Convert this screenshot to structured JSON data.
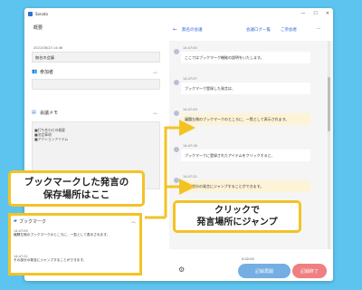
{
  "app": {
    "title": "Sonato"
  },
  "left": {
    "header": "概要",
    "date": "2021/08/23 14:46",
    "meeting_name": "無名の会議",
    "participants_label": "参加者",
    "memo_label": "会議メモ",
    "memo_lines": [
      "■打ち合わせの概要",
      "■決定事項",
      "■アクションアイテム"
    ],
    "bookmark_label": "ブックマーク",
    "bookmarks": [
      {
        "time": "14:47:09",
        "text": "議題左側のブックマークのところに、一覧として表示されます。"
      },
      {
        "time": "14:47:22",
        "text": "その部分の発言にジャンプすることができます。"
      }
    ]
  },
  "right": {
    "meeting_link": "無名の会議",
    "log_link": "会議ログ一覧",
    "users_link": "ご参加者",
    "messages": [
      {
        "time": "14:47:00",
        "text": "ここではブックマーク機能の説明をいたします。",
        "highlight": false
      },
      {
        "time": "14:47:07",
        "text": "ブックマーク登録した発言は、",
        "highlight": false
      },
      {
        "time": "14:47:09",
        "text": "議題左側のブックマークのところに、一覧として表示されます。",
        "highlight": true
      },
      {
        "time": "14:47:18",
        "text": "ブックマークに登録されたアイテムをクリックすると、",
        "highlight": false
      },
      {
        "time": "14:47:22",
        "text": "その部分の発言にジャンプすることができます。",
        "highlight": true
      }
    ],
    "elapsed": "0:02:00",
    "resume_label": "記録再開",
    "end_label": "記録終了"
  },
  "callouts": {
    "left_line1": "ブックマークした発言の",
    "left_line2": "保存場所はここ",
    "right_line1": "クリックで",
    "right_line2": "発言場所にジャンプ"
  },
  "colors": {
    "accent": "#2f6fd6",
    "highlight": "#f3c324",
    "background": "#5dc4ef",
    "resume": "#74aee3",
    "end": "#ef7f82"
  }
}
